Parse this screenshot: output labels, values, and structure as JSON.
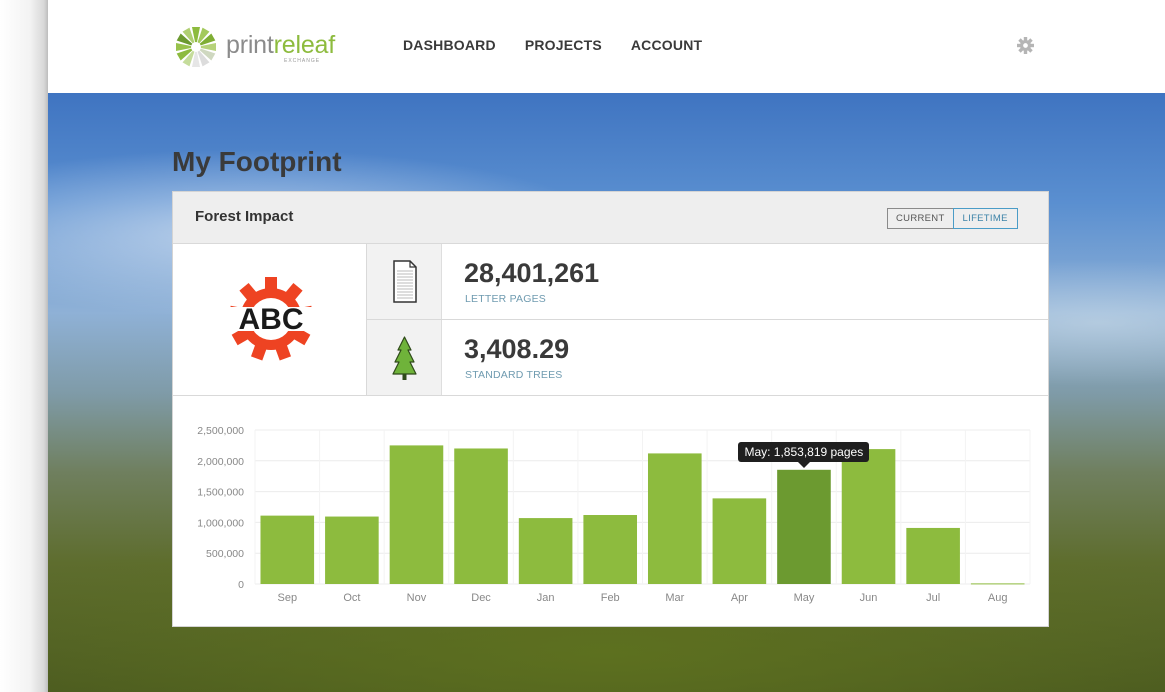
{
  "brand": {
    "name_gray": "print",
    "name_green": "releaf",
    "tagline": "EXCHANGE"
  },
  "nav": {
    "links": [
      "DASHBOARD",
      "PROJECTS",
      "ACCOUNT"
    ]
  },
  "page": {
    "title": "My Footprint"
  },
  "panel": {
    "title": "Forest Impact",
    "toggle": [
      "CURRENT",
      "LIFETIME"
    ],
    "active_toggle": "LIFETIME",
    "client_logo_text": "ABC",
    "stats": [
      {
        "icon": "document-icon",
        "value": "28,401,261",
        "label": "LETTER PAGES"
      },
      {
        "icon": "tree-icon",
        "value": "3,408.29",
        "label": "STANDARD TREES"
      }
    ]
  },
  "colors": {
    "bar": "#8dbb3e",
    "bar_highlight": "#6c9a30",
    "accent_blue": "#4a9cc7",
    "brand_green": "#8dbb3e",
    "logo_orange": "#ee4322"
  },
  "chart_data": {
    "type": "bar",
    "categories": [
      "Sep",
      "Oct",
      "Nov",
      "Dec",
      "Jan",
      "Feb",
      "Mar",
      "Apr",
      "May",
      "Jun",
      "Jul",
      "Aug"
    ],
    "values": [
      1110000,
      1095000,
      2250000,
      2200000,
      1070000,
      1120000,
      2120000,
      1390000,
      1853819,
      2190000,
      910000,
      10000
    ],
    "ylim": [
      0,
      2500000
    ],
    "yticks": [
      "2,500,000",
      "2,000,000",
      "1,500,000",
      "1,000,000",
      "500,000",
      "0"
    ],
    "grid": true,
    "highlight_index": 8,
    "tooltip": "May: 1,853,819 pages"
  }
}
